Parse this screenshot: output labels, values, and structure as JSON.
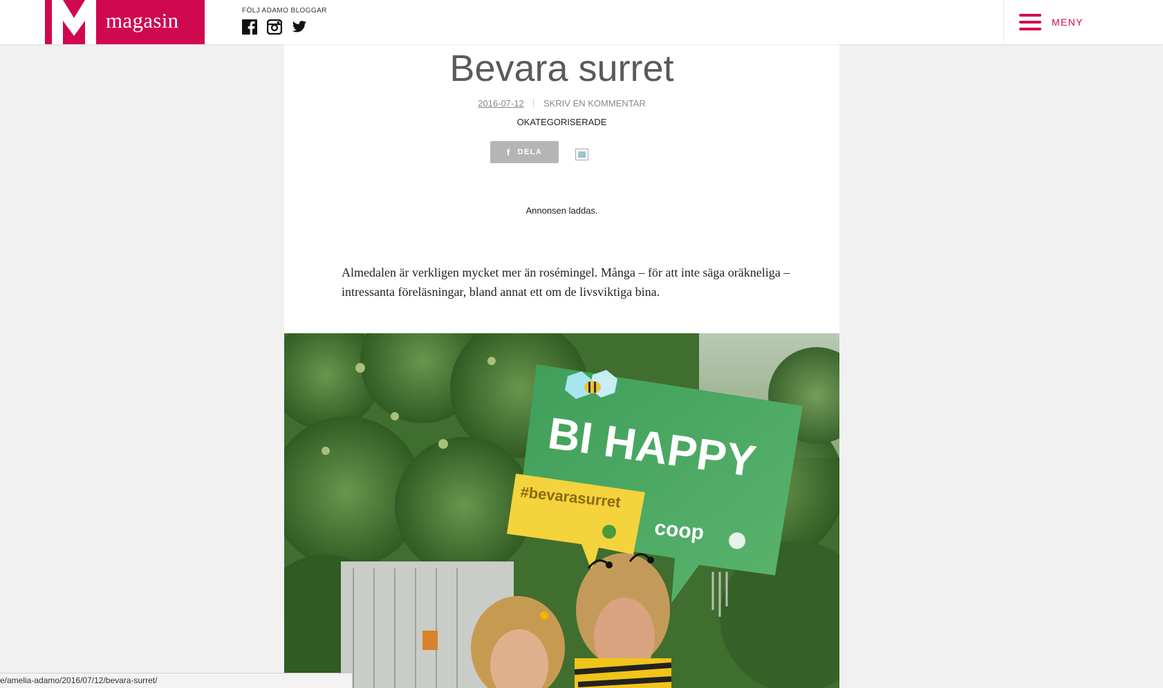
{
  "header": {
    "logo_text": "magasin",
    "follow_label": "FÖLJ ADAMO BLOGGAR",
    "social": [
      "facebook-icon",
      "instagram-icon",
      "twitter-icon"
    ],
    "menu_label": "MENY",
    "brand_color": "#d0084f"
  },
  "article": {
    "title": "Bevara surret",
    "date": "2016-07-12",
    "comment_link": "SKRIV EN KOMMENTAR",
    "category": "OKATEGORISERADE",
    "share_label": "DELA",
    "ad_text": "Annonsen laddas.",
    "body": "Almedalen är verkligen mycket mer än rosémingel. Många – för att inte säga oräkneliga – intressanta föreläsningar, bland annat ett om de livsviktiga bina.",
    "photo": {
      "sign_text": "BI HAPPY",
      "hashtag": "#bevarasurret",
      "brand": "coop"
    }
  },
  "statusbar": {
    "url": "e/amelia-adamo/2016/07/12/bevara-surret/"
  }
}
